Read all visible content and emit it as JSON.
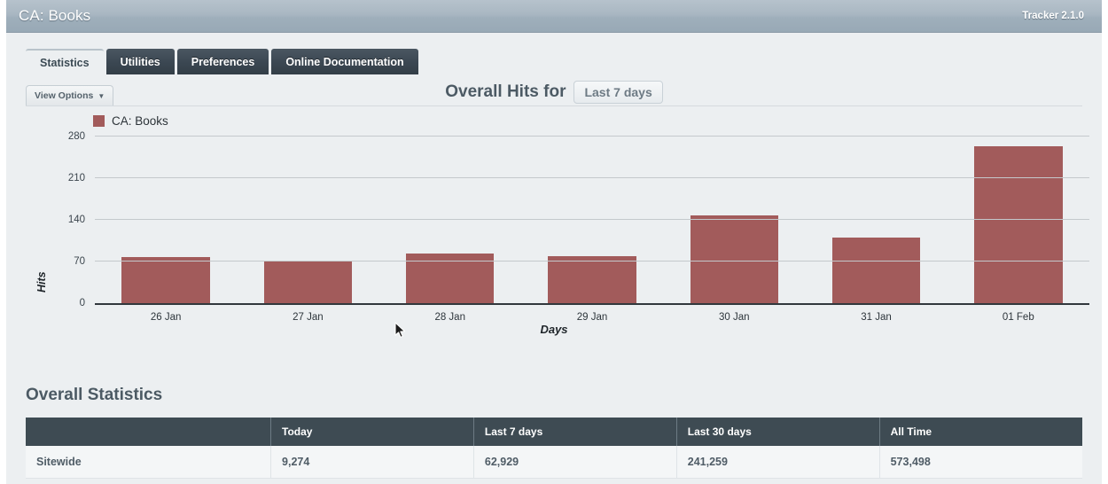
{
  "titlebar": {
    "title": "CA: Books",
    "version": "Tracker 2.1.0"
  },
  "tabs": [
    {
      "label": "Statistics",
      "active": true
    },
    {
      "label": "Utilities",
      "active": false
    },
    {
      "label": "Preferences",
      "active": false
    },
    {
      "label": "Online Documentation",
      "active": false
    }
  ],
  "toolbar": {
    "view_options_label": "View Options",
    "view_options_caret": "▼"
  },
  "chart_header": {
    "title_prefix": "Overall Hits for",
    "range_value": "Last 7 days"
  },
  "colors": {
    "bar": "#a25b5b",
    "titlebar": "#a9b7c2",
    "tab_inactive": "#3b4752",
    "table_header": "#3e4b53",
    "panel_bg": "#eceff1"
  },
  "chart_data": {
    "type": "bar",
    "title": "Overall Hits for Last 7 days",
    "xlabel": "Days",
    "ylabel": "Hits",
    "categories": [
      "26 Jan",
      "27 Jan",
      "28 Jan",
      "29 Jan",
      "30 Jan",
      "31 Jan",
      "01 Feb"
    ],
    "values": [
      77,
      71,
      83,
      79,
      147,
      110,
      263
    ],
    "series": [
      {
        "name": "CA: Books",
        "color": "#a25b5b",
        "values": [
          77,
          71,
          83,
          79,
          147,
          110,
          263
        ]
      }
    ],
    "yticks": [
      0,
      70,
      140,
      210,
      280
    ],
    "ylim": [
      0,
      280
    ],
    "grid": true,
    "legend": [
      "CA: Books"
    ],
    "legend_position": "top-left"
  },
  "stats": {
    "heading": "Overall Statistics",
    "columns": [
      "",
      "Today",
      "Last 7 days",
      "Last 30 days",
      "All Time"
    ],
    "rows": [
      {
        "name": "Sitewide",
        "today": "9,274",
        "last7": "62,929",
        "last30": "241,259",
        "alltime": "573,498"
      }
    ]
  }
}
